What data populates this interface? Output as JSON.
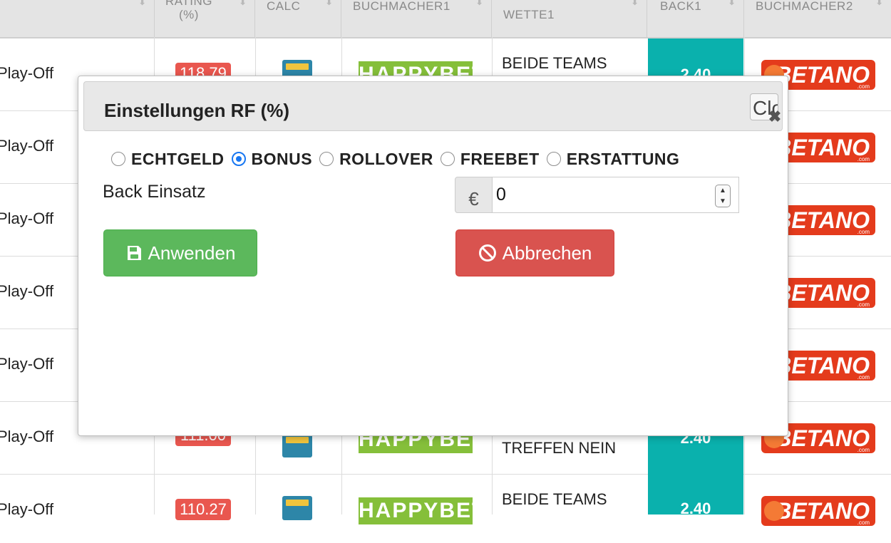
{
  "table": {
    "headers": [
      {
        "label": "",
        "sub": ""
      },
      {
        "label": "RATING",
        "sub": "(%)"
      },
      {
        "label": "CALC",
        "sub": ""
      },
      {
        "label": "BUCHMACHER1",
        "sub": ""
      },
      {
        "label": "",
        "sub": "WETTE1"
      },
      {
        "label": "BACK1",
        "sub": ""
      },
      {
        "label": "BUCHMACHER2",
        "sub": ""
      }
    ],
    "rows": [
      {
        "event": "Play-Off",
        "rating": "118.79",
        "bookmaker1": "HAPPYBET",
        "bet_line1": "BEIDE TEAMS",
        "bet_line2": "",
        "back1": "2.40",
        "bookmaker2": "BETANO"
      },
      {
        "event": "Play-Off",
        "rating": "",
        "bookmaker1": "",
        "bet_line1": "",
        "bet_line2": "",
        "back1": "",
        "bookmaker2": "BETANO"
      },
      {
        "event": "Play-Off",
        "rating": "",
        "bookmaker1": "",
        "bet_line1": "",
        "bet_line2": "",
        "back1": "",
        "bookmaker2": "BETANO"
      },
      {
        "event": "Play-Off",
        "rating": "",
        "bookmaker1": "",
        "bet_line1": "",
        "bet_line2": "",
        "back1": "",
        "bookmaker2": "BETANO"
      },
      {
        "event": "Play-Off",
        "rating": "",
        "bookmaker1": "",
        "bet_line1": "",
        "bet_line2": "",
        "back1": "",
        "bookmaker2": "BETANO"
      },
      {
        "event": "Play-Off",
        "rating": "111.00",
        "bookmaker1": "HAPPYBET",
        "bet_line1": "",
        "bet_line2": "TREFFEN NEIN",
        "back1": "2.40",
        "bookmaker2": "BETANO"
      },
      {
        "event": "Play-Off",
        "rating": "110.27",
        "bookmaker1": "HAPPYBET",
        "bet_line1": "BEIDE TEAMS",
        "bet_line2": "",
        "back1": "2.40",
        "bookmaker2": "BETANO"
      }
    ],
    "bookmaker2_suffix": ".com"
  },
  "modal": {
    "title": "Einstellungen RF (%)",
    "close_label": "Clo",
    "close_icon": "✖",
    "radio_options": [
      "ECHTGELD",
      "BONUS",
      "ROLLOVER",
      "FREEBET",
      "ERSTATTUNG"
    ],
    "selected_option": "BONUS",
    "back_stake_label": "Back Einsatz",
    "currency_symbol": "€",
    "back_stake_value": "0",
    "apply_label": "Anwenden",
    "cancel_label": "Abbrechen"
  },
  "colors": {
    "apply": "#5cb85c",
    "cancel": "#d9534f",
    "rating_badge": "#e9574f",
    "back_cell": "#0ab1ad",
    "happybet": "#85bf3a",
    "betano": "#e43b1c",
    "radio_selected": "#1877f2"
  }
}
